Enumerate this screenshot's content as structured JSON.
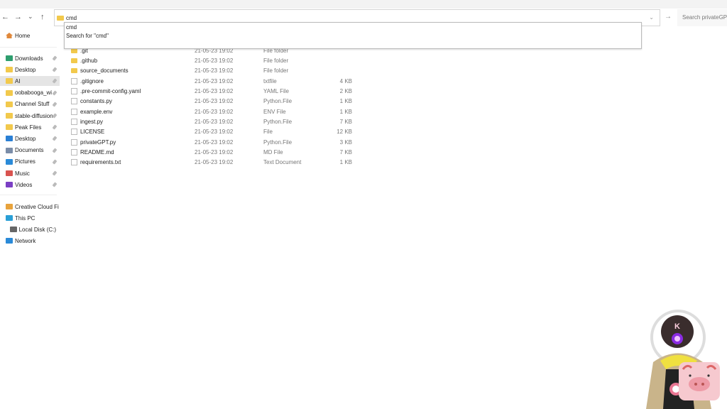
{
  "nav": {
    "back": "←",
    "forward": "→",
    "recent": "⌄",
    "up": "↑"
  },
  "address": {
    "value": "cmd",
    "go": "→",
    "dropdown_chevron": "⌄"
  },
  "search": {
    "placeholder": "Search privateGPT"
  },
  "suggestions": [
    "cmd",
    "Search for \"cmd\""
  ],
  "sidebar": {
    "home": "Home",
    "quick": [
      {
        "label": "Downloads",
        "color": "#2e9e6e"
      },
      {
        "label": "Desktop",
        "color": "#f2c94c"
      },
      {
        "label": "AI",
        "color": "#f2c94c",
        "selected": true
      },
      {
        "label": "oobabooga_wi",
        "color": "#f2c94c"
      },
      {
        "label": "Channel Stuff",
        "color": "#f2c94c"
      },
      {
        "label": "stable-diffusion",
        "color": "#f2c94c"
      },
      {
        "label": "Peak Files",
        "color": "#f2c94c"
      },
      {
        "label": "Desktop",
        "color": "#2a7fd4"
      },
      {
        "label": "Documents",
        "color": "#7b8da8"
      },
      {
        "label": "Pictures",
        "color": "#2a8ad8"
      },
      {
        "label": "Music",
        "color": "#d9534f"
      },
      {
        "label": "Videos",
        "color": "#7b3fc4"
      }
    ],
    "other": [
      {
        "label": "Creative Cloud Files",
        "color": "#e8a33c"
      },
      {
        "label": "This PC",
        "color": "#2a9fd6"
      },
      {
        "label": "Local Disk (C:)",
        "color": "#666"
      },
      {
        "label": "Network",
        "color": "#2a8ad8"
      }
    ]
  },
  "files": [
    {
      "name": ".git",
      "date": "21-05-23 19:02",
      "type": "File folder",
      "size": "",
      "kind": "folder"
    },
    {
      "name": ".github",
      "date": "21-05-23 19:02",
      "type": "File folder",
      "size": "",
      "kind": "folder"
    },
    {
      "name": "source_documents",
      "date": "21-05-23 19:02",
      "type": "File folder",
      "size": "",
      "kind": "folder"
    },
    {
      "name": ".gitignore",
      "date": "21-05-23 19:02",
      "type": "txtfile",
      "size": "4 KB",
      "kind": "file"
    },
    {
      "name": ".pre-commit-config.yaml",
      "date": "21-05-23 19:02",
      "type": "YAML File",
      "size": "2 KB",
      "kind": "file"
    },
    {
      "name": "constants.py",
      "date": "21-05-23 19:02",
      "type": "Python.File",
      "size": "1 KB",
      "kind": "file"
    },
    {
      "name": "example.env",
      "date": "21-05-23 19:02",
      "type": "ENV File",
      "size": "1 KB",
      "kind": "file"
    },
    {
      "name": "ingest.py",
      "date": "21-05-23 19:02",
      "type": "Python.File",
      "size": "7 KB",
      "kind": "file"
    },
    {
      "name": "LICENSE",
      "date": "21-05-23 19:02",
      "type": "File",
      "size": "12 KB",
      "kind": "file"
    },
    {
      "name": "privateGPT.py",
      "date": "21-05-23 19:02",
      "type": "Python.File",
      "size": "3 KB",
      "kind": "file"
    },
    {
      "name": "README.md",
      "date": "21-05-23 19:02",
      "type": "MD File",
      "size": "7 KB",
      "kind": "file"
    },
    {
      "name": "requirements.txt",
      "date": "21-05-23 19:02",
      "type": "Text Document",
      "size": "1 KB",
      "kind": "file"
    }
  ],
  "overlay": {
    "badge": "K"
  }
}
